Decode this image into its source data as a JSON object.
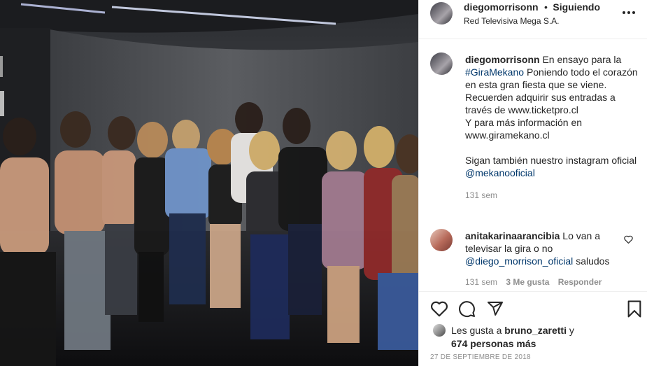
{
  "post": {
    "author": "diegomorrisonn",
    "separator": "•",
    "follow_label": "Siguiendo",
    "location": "Red Televisiva Mega S.A."
  },
  "caption": {
    "author": "diegomorrisonn",
    "text_1": "En ensayo para la",
    "hashtag": "#GiraMekano",
    "text_2": "Poniendo todo el corazón en esta gran fiesta que se viene.",
    "line_3": "Recuerden adquirir sus entradas a través de www.ticketpro.cl",
    "line_4": "Y para más información en www.giramekano.cl",
    "line_5": "Sigan también nuestro instagram oficial",
    "mention": "@mekanooficial",
    "time": "131 sem"
  },
  "comment": {
    "author": "anitakarinaarancibia",
    "text": "Lo van a televisar la gira o no",
    "mention": "@diego_morrison_oficial",
    "text_after": "saludos",
    "time": "131 sem",
    "likes": "3 Me gusta",
    "reply_label": "Responder"
  },
  "likes": {
    "prefix": "Les gusta a",
    "user": "bruno_zaretti",
    "connector": "y",
    "others": "674 personas más"
  },
  "date": "27 DE SEPTIEMBRE DE 2018",
  "icons": [
    "heart-icon",
    "comment-icon",
    "share-icon",
    "bookmark-icon",
    "more-options-icon"
  ],
  "colors": {
    "link": "#00376b",
    "muted": "#8e8e8e",
    "text": "#262626"
  }
}
